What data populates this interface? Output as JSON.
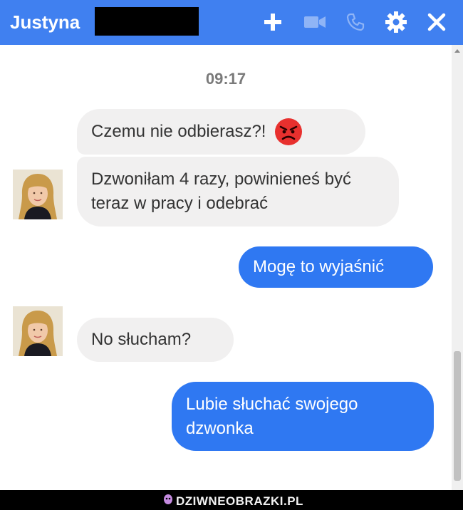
{
  "header": {
    "contact_name": "Justyna",
    "icons": [
      "plus-icon",
      "video-camera-icon",
      "phone-icon",
      "gear-icon",
      "close-icon"
    ],
    "background_color": "#4080f0"
  },
  "conversation": {
    "timestamp": "09:17",
    "messages": [
      {
        "sender": "contact",
        "text": "Czemu nie odbierasz?!",
        "emoji": "angry-face-icon"
      },
      {
        "sender": "contact",
        "text": "Dzwoniłam 4 razy, powinieneś być teraz w pracy i odebrać"
      },
      {
        "sender": "me",
        "text": "Mogę to wyjaśnić"
      },
      {
        "sender": "contact",
        "text": "No słucham?"
      },
      {
        "sender": "me",
        "text": "Lubie słuchać swojego dzwonka"
      }
    ],
    "outgoing_color": "#2f78f2",
    "incoming_color": "#f1f0f0"
  },
  "footer": {
    "watermark": "DZIWNEOBRAZKI.PL"
  }
}
